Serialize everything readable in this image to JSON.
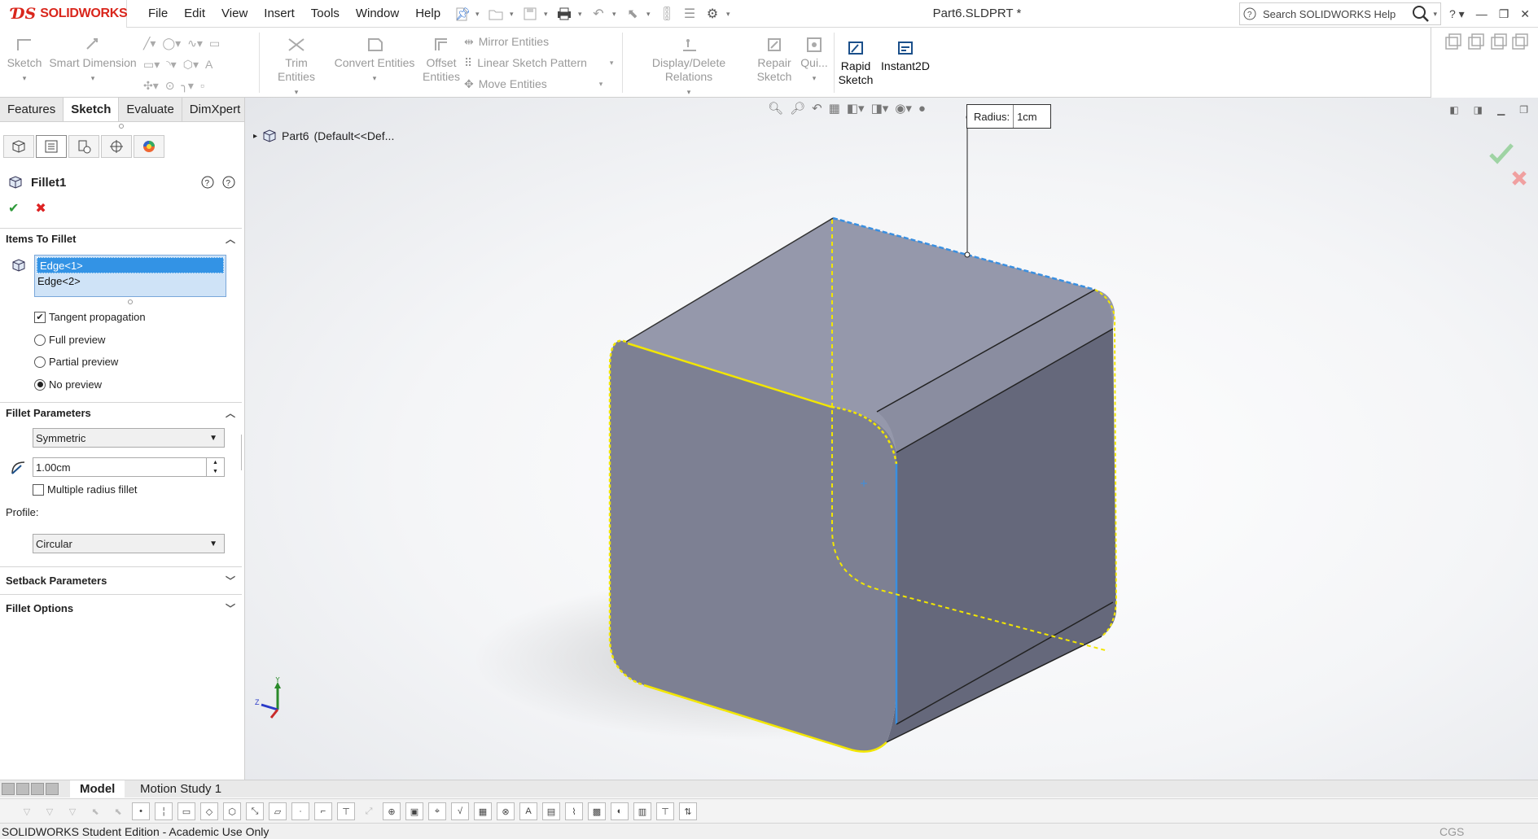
{
  "app": {
    "brand": "SOLIDWORKS",
    "document_title": "Part6.SLDPRT *",
    "menus": [
      "File",
      "Edit",
      "View",
      "Insert",
      "Tools",
      "Window",
      "Help"
    ],
    "search_placeholder": "Search SOLIDWORKS Help"
  },
  "command_manager": {
    "sketch": "Sketch",
    "smart_dimension": "Smart Dimension",
    "trim_entities": "Trim Entities",
    "convert_entities": "Convert Entities",
    "offset_line1": "Offset",
    "offset_line2": "Entities",
    "mirror_entities": "Mirror Entities",
    "linear_sketch_pattern": "Linear Sketch Pattern",
    "move_entities": "Move Entities",
    "display_delete_relations": "Display/Delete Relations",
    "repair_line1": "Repair",
    "repair_line2": "Sketch",
    "quick": "Qui...",
    "rapid_line1": "Rapid",
    "rapid_line2": "Sketch",
    "instant2d": "Instant2D"
  },
  "manager_tabs": [
    "Features",
    "Sketch",
    "Evaluate",
    "DimXpert"
  ],
  "property_manager": {
    "title": "Fillet1",
    "items_to_fillet": {
      "heading": "Items To Fillet",
      "edges": [
        "Edge<1>",
        "Edge<2>"
      ],
      "tangent_propagation": "Tangent propagation",
      "tangent_propagation_checked": true,
      "preview_options": [
        "Full preview",
        "Partial preview",
        "No preview"
      ],
      "preview_selected": "No preview"
    },
    "fillet_parameters": {
      "heading": "Fillet Parameters",
      "type": "Symmetric",
      "radius": "1.00cm",
      "multiple_radius": "Multiple radius fillet",
      "profile_label": "Profile:",
      "profile": "Circular"
    },
    "setback_parameters": "Setback Parameters",
    "fillet_options": "Fillet Options"
  },
  "viewport": {
    "tree_root": "Part6",
    "tree_config": "(Default<<Def...",
    "callout_label": "Radius:",
    "callout_value": "1cm",
    "triad_axes": [
      "Y",
      "Z"
    ]
  },
  "bottom_tabs": [
    "Model",
    "Motion Study 1"
  ],
  "status": {
    "text": "SOLIDWORKS Student Edition - Academic Use Only",
    "units": "CGS"
  },
  "colors": {
    "brand_red": "#d9261c",
    "selection_blue": "#3393e5",
    "edge_highlight_yellow": "#f2e600",
    "edge_preview_blue": "#3a8fe0",
    "model_face_front": "#7d8093",
    "model_face_top": "#9598ab",
    "model_face_right": "#65687b"
  }
}
